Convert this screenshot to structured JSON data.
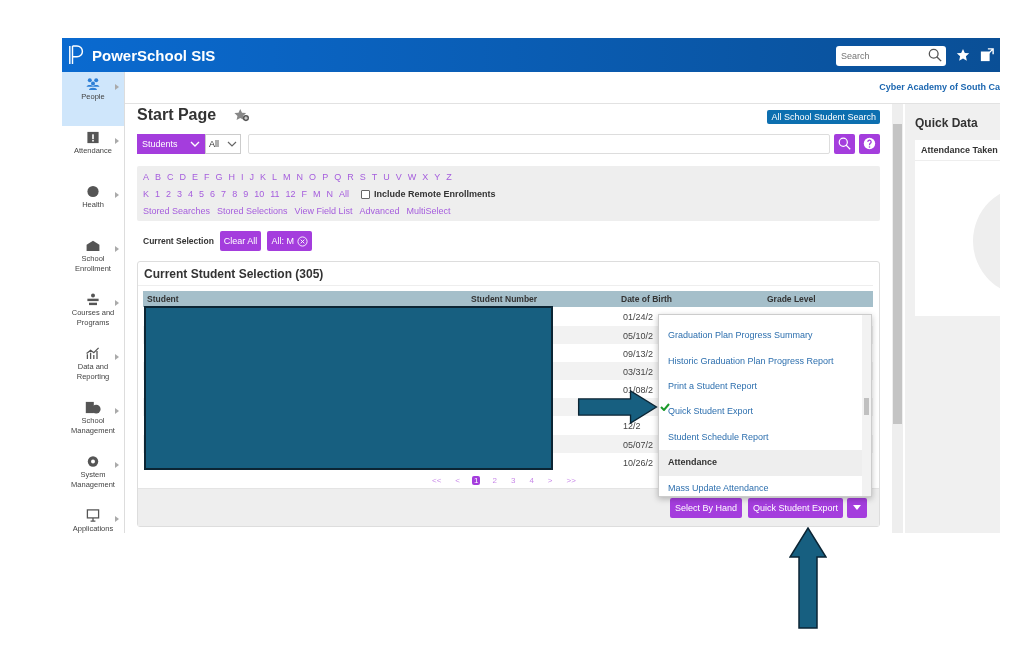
{
  "app": {
    "title": "PowerSchool SIS",
    "search": {
      "placeholder": "Search"
    },
    "school": "Cyber Academy of South Ca"
  },
  "sidebar": {
    "items": [
      {
        "label": "People",
        "selected": true
      },
      {
        "label": "Attendance",
        "selected": false
      },
      {
        "label": "Health",
        "selected": false
      },
      {
        "label": "School Enrollment",
        "selected": false
      },
      {
        "label": "Courses and Programs",
        "selected": false
      },
      {
        "label": "Data and Reporting",
        "selected": false
      },
      {
        "label": "School Management",
        "selected": false
      },
      {
        "label": "System Management",
        "selected": false
      },
      {
        "label": "Applications",
        "selected": false
      }
    ]
  },
  "page": {
    "title": "Start Page",
    "all_school_search": "All School Student Search",
    "search_bar": {
      "type_select": "Students",
      "scope_select": "All"
    },
    "filters": {
      "letters": [
        "A",
        "B",
        "C",
        "D",
        "E",
        "F",
        "G",
        "H",
        "I",
        "J",
        "K",
        "L",
        "M",
        "N",
        "O",
        "P",
        "Q",
        "R",
        "S",
        "T",
        "U",
        "V",
        "W",
        "X",
        "Y",
        "Z"
      ],
      "grades": [
        "K",
        "1",
        "2",
        "3",
        "4",
        "5",
        "6",
        "7",
        "8",
        "9",
        "10",
        "11",
        "12",
        "F",
        "M",
        "N",
        "All"
      ],
      "include_remote": {
        "label": "Include Remote Enrollments",
        "checked": false
      },
      "links": [
        "Stored Searches",
        "Stored Selections",
        "View Field List",
        "Advanced",
        "MultiSelect"
      ]
    },
    "current_selection": {
      "label": "Current Selection",
      "clear": "Clear All",
      "chips": [
        "All: M"
      ]
    }
  },
  "selection": {
    "title": "Current Student Selection (305)",
    "columns": [
      "Student",
      "Student Number",
      "Date of Birth",
      "Grade Level"
    ],
    "rows": [
      {
        "date_of_birth": "01/24/2"
      },
      {
        "date_of_birth": "05/10/2"
      },
      {
        "date_of_birth": "09/13/2"
      },
      {
        "date_of_birth": "03/31/2"
      },
      {
        "date_of_birth": "01/08/2"
      },
      {},
      {
        "date_of_birth": "12/2"
      },
      {
        "date_of_birth": "05/07/2"
      },
      {
        "date_of_birth": "10/26/2"
      }
    ],
    "pagination": [
      {
        "label": "<<",
        "selected": false
      },
      {
        "label": "<",
        "selected": false
      },
      {
        "label": "1",
        "selected": true
      },
      {
        "label": "2",
        "selected": false
      },
      {
        "label": "3",
        "selected": false
      },
      {
        "label": "4",
        "selected": false
      },
      {
        "label": ">",
        "selected": false
      },
      {
        "label": ">>",
        "selected": false
      }
    ],
    "menu": [
      {
        "kind": "item",
        "label": "Graduation Plan Progress Summary",
        "checked": false
      },
      {
        "kind": "item",
        "label": "Historic Graduation Plan Progress Report",
        "checked": false
      },
      {
        "kind": "item",
        "label": "Print a Student Report",
        "checked": false
      },
      {
        "kind": "item",
        "label": "Quick Student Export",
        "checked": true
      },
      {
        "kind": "item",
        "label": "Student Schedule Report",
        "checked": false
      },
      {
        "kind": "header",
        "label": "Attendance",
        "checked": false
      },
      {
        "kind": "item",
        "label": "Mass Update Attendance",
        "checked": false
      }
    ],
    "buttons": [
      "Select By Hand",
      "Quick Student Export"
    ]
  },
  "quick_data": {
    "title": "Quick Data",
    "card_title": "Attendance Taken"
  }
}
